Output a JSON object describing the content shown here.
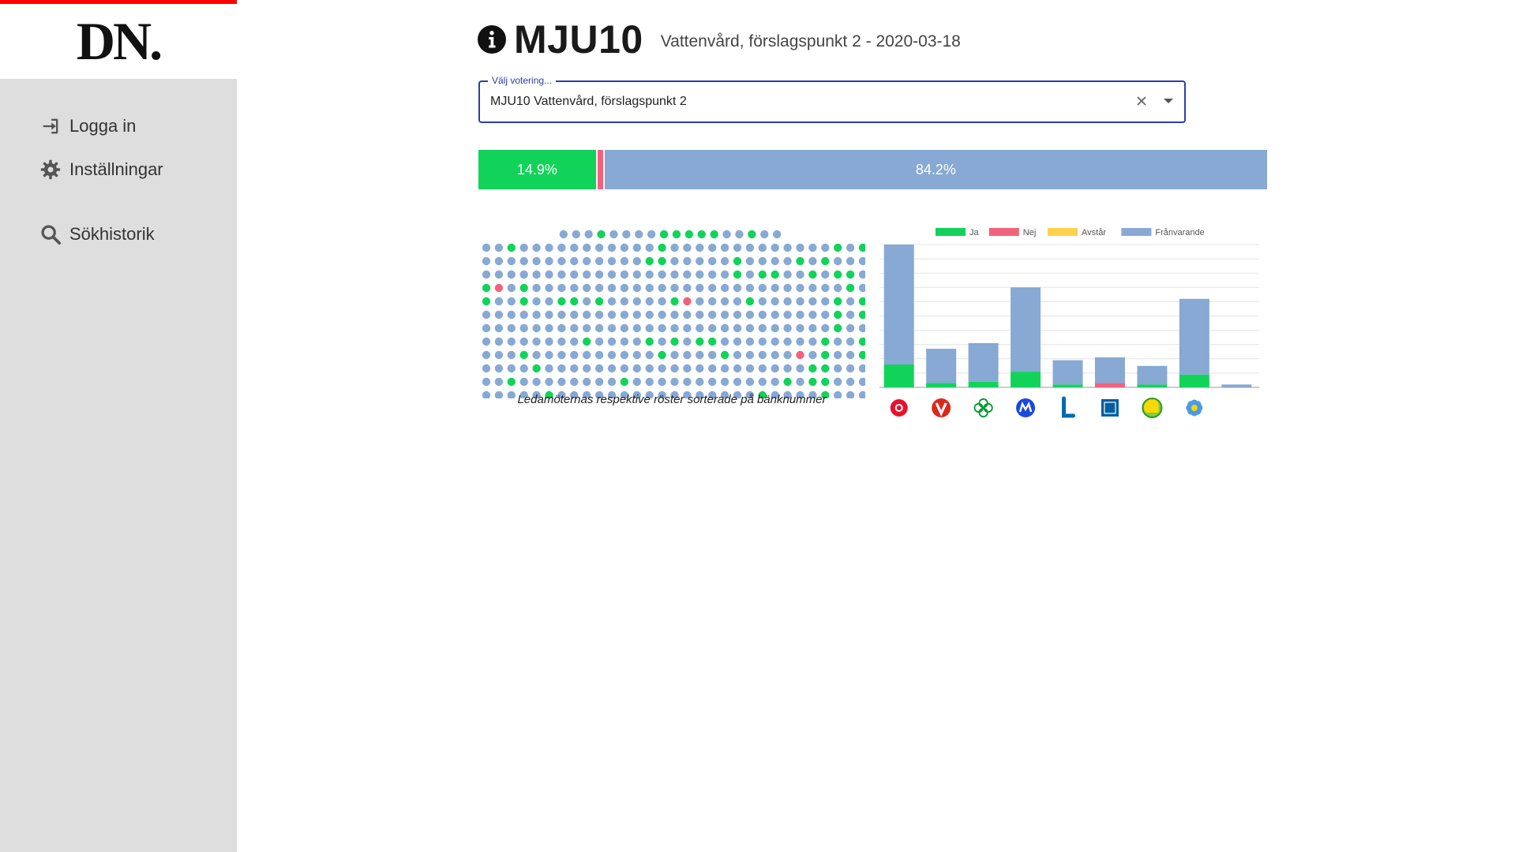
{
  "sidebar": {
    "logo": "DN.",
    "items": [
      {
        "label": "Logga in",
        "icon": "sign-in-icon"
      },
      {
        "label": "Inställningar",
        "icon": "gear-icon"
      },
      {
        "label": "Sökhistorik",
        "icon": "search-icon"
      }
    ]
  },
  "header": {
    "title": "MJU10",
    "subtitle": "Vattenvård, förslagspunkt 2 - 2020-03-18"
  },
  "vote_select": {
    "label": "Välj votering...",
    "value": "MJU10 Vattenvård, förslagspunkt 2"
  },
  "result_bar": {
    "ja_pct": 14.9,
    "nej_pct": 0.9,
    "franvarande_pct": 84.2,
    "ja_label": "14.9%",
    "franvarande_label": "84.2%"
  },
  "colors": {
    "ja": "#12d35a",
    "nej": "#f3627d",
    "avstar": "#ffd24d",
    "franvarande": "#87a9d4",
    "select_accent": "#2c3ea8"
  },
  "seat_chart": {
    "caption": "Ledamöternas respektive röster sorterade på bänknummer",
    "top_row": "fffnffffnnnnnffnff",
    "rows": [
      "ffnfffffffffffnfffffffffffffnfn",
      "fffffffffffffnnfffffnffffnfnfff",
      "ffffffffffffffffffffnfnnffnfnnf",
      "nnfnfffffffffffffffffffffffffnf",
      "nffnffnnfnfffffnfffffnffffffnfn",
      "ffffffffffffffffffffffffffffnfn",
      "ffffffffffffffffffffffffffffnff",
      "ffffffffnffffnfnfnnffffffffnffn",
      "fffnffffffffffnffffnfffffnfnffn",
      "ffffnfffffffffffffffffffffnnfff",
      "ffnffffffffnffffffffffffnfnnfff",
      "fffffnffffffffffffffffnffffnfff"
    ],
    "nej_seats": [
      [
        3,
        1
      ],
      [
        4,
        16
      ],
      [
        8,
        25
      ]
    ]
  },
  "chart_data": {
    "type": "bar",
    "stacked": true,
    "categories": [
      "S",
      "V",
      "C",
      "M",
      "L",
      "KD",
      "MP",
      "SD",
      "-"
    ],
    "legend_position": "top",
    "grid": true,
    "ylim": [
      0,
      100
    ],
    "series": [
      {
        "name": "Ja",
        "color": "#12d35a",
        "values": [
          16,
          3,
          4,
          11,
          2,
          0,
          2,
          9,
          0
        ]
      },
      {
        "name": "Nej",
        "color": "#f3627d",
        "values": [
          0,
          0,
          0,
          0,
          0,
          3,
          0,
          0,
          0
        ]
      },
      {
        "name": "Avstår",
        "color": "#ffd24d",
        "values": [
          0,
          0,
          0,
          0,
          0,
          0,
          0,
          0,
          0
        ]
      },
      {
        "name": "Frånvarande",
        "color": "#87a9d4",
        "values": [
          84,
          24,
          27,
          59,
          17,
          18,
          13,
          53,
          2
        ]
      }
    ]
  }
}
